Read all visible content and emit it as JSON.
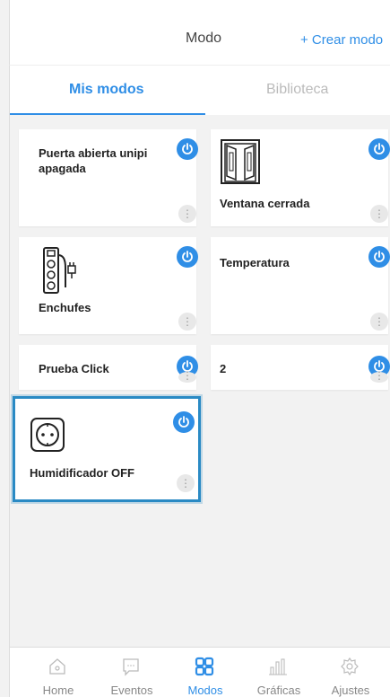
{
  "header": {
    "title": "Modo",
    "create_label": "+ Crear modo"
  },
  "tabs": {
    "active": "Mis modos",
    "inactive": "Biblioteca"
  },
  "cards": [
    {
      "name": "Puerta abierta unipi apagada",
      "icon": "none"
    },
    {
      "name": "Ventana cerrada",
      "icon": "window-icon"
    },
    {
      "name": "Enchufes",
      "icon": "power-strip-icon"
    },
    {
      "name": "Temperatura",
      "icon": "none"
    },
    {
      "name": "Prueba Click",
      "icon": "none"
    },
    {
      "name": "2",
      "icon": "none"
    },
    {
      "name": "Humidificador OFF",
      "icon": "socket-icon"
    }
  ],
  "more_glyph": "⋮",
  "nav": {
    "items": [
      {
        "label": "Home",
        "icon": "home-icon"
      },
      {
        "label": "Eventos",
        "icon": "chat-icon"
      },
      {
        "label": "Modos",
        "icon": "grid-icon",
        "active": true
      },
      {
        "label": "Gráficas",
        "icon": "bar-chart-icon"
      },
      {
        "label": "Ajustes",
        "icon": "gear-icon"
      }
    ]
  },
  "colors": {
    "accent": "#2f8ee6",
    "highlight": "#2a8ac4",
    "background": "#f2f2f2"
  }
}
